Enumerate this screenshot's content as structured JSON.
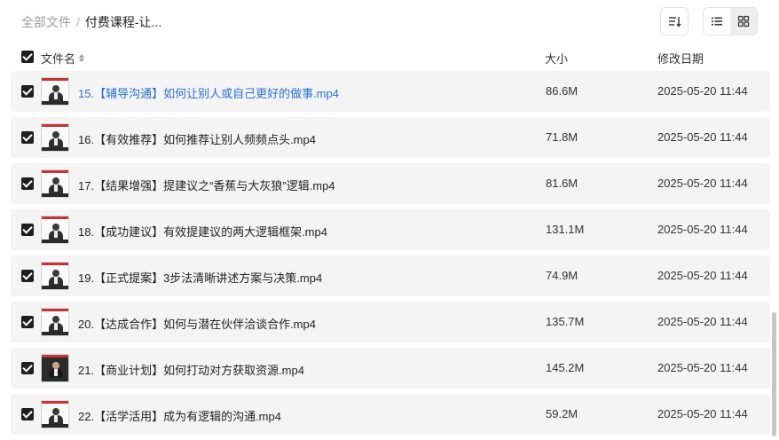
{
  "breadcrumb": {
    "root": "全部文件",
    "separator": "/",
    "current": "付费课程-让..."
  },
  "toolbar": {
    "sort_icon": "sort-list-icon",
    "view_list_icon": "list-view-icon",
    "view_grid_icon": "grid-view-icon",
    "active_view": "list"
  },
  "columns": {
    "name": "文件名",
    "size": "大小",
    "modified": "修改日期"
  },
  "files": [
    {
      "name": "15.【辅导沟通】如何让别人或自己更好的做事.mp4",
      "size": "86.6M",
      "date": "2025-05-20 11:44",
      "checked": true,
      "highlight": true
    },
    {
      "name": "16.【有效推荐】如何推荐让别人频频点头.mp4",
      "size": "71.8M",
      "date": "2025-05-20 11:44",
      "checked": true
    },
    {
      "name": "17.【结果增强】提建议之“香蕉与大灰狼”逻辑.mp4",
      "size": "81.6M",
      "date": "2025-05-20 11:44",
      "checked": true
    },
    {
      "name": "18.【成功建议】有效提建议的两大逻辑框架.mp4",
      "size": "131.1M",
      "date": "2025-05-20 11:44",
      "checked": true
    },
    {
      "name": "19.【正式提案】3步法清晰讲述方案与决策.mp4",
      "size": "74.9M",
      "date": "2025-05-20 11:44",
      "checked": true
    },
    {
      "name": "20.【达成合作】如何与潜在伙伴洽谈合作.mp4",
      "size": "135.7M",
      "date": "2025-05-20 11:44",
      "checked": true
    },
    {
      "name": "21.【商业计划】如何打动对方获取资源.mp4",
      "size": "145.2M",
      "date": "2025-05-20 11:44",
      "checked": true
    },
    {
      "name": "22.【活学活用】成为有逻辑的沟通.mp4",
      "size": "59.2M",
      "date": "2025-05-20 11:44",
      "checked": true
    }
  ],
  "colors": {
    "link": "#2a6fd6",
    "row_bg": "#f4f4f4",
    "checkbox": "#1f1f1f"
  }
}
